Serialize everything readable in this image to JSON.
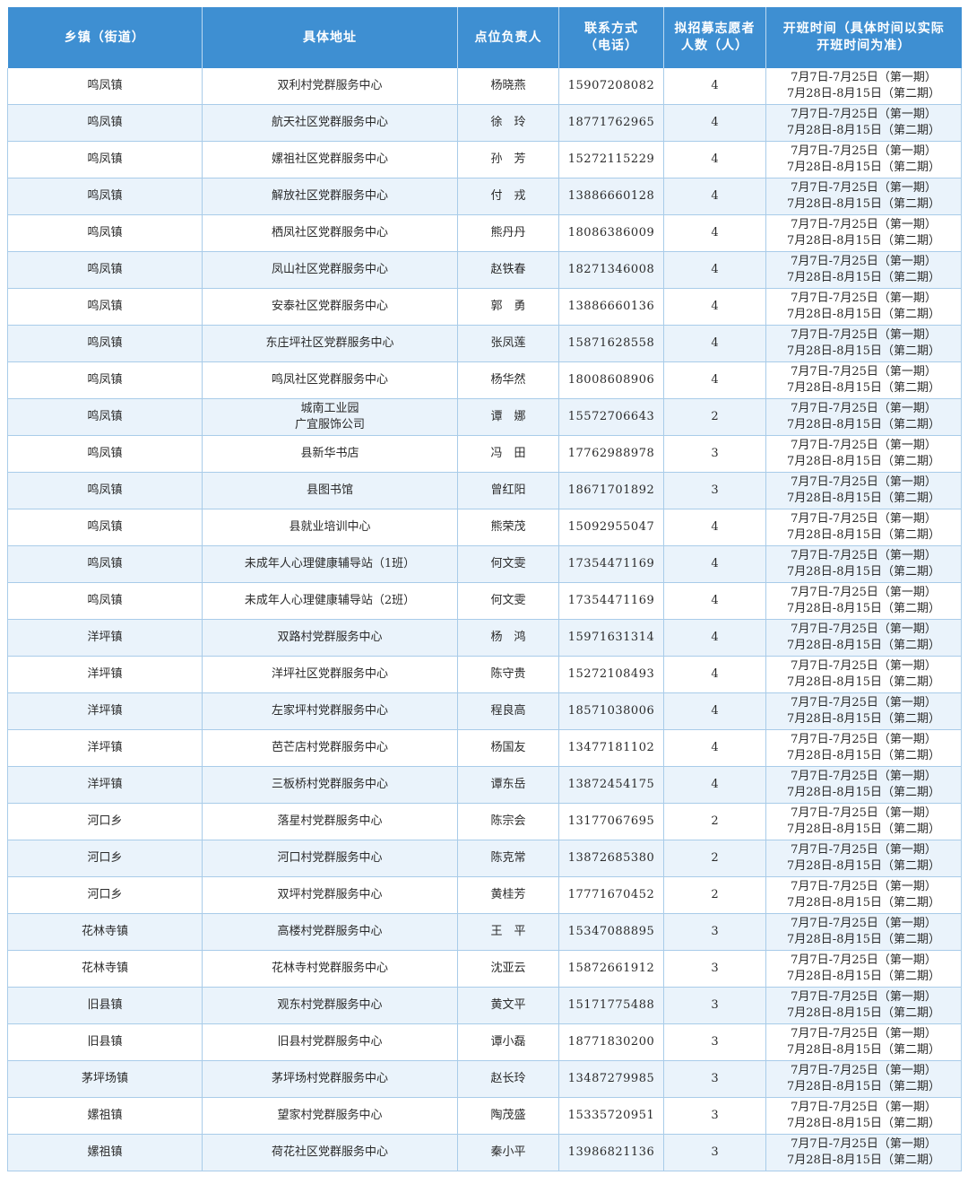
{
  "headers": [
    {
      "line1": "乡镇（街道）",
      "line2": ""
    },
    {
      "line1": "具体地址",
      "line2": ""
    },
    {
      "line1": "点位负责人",
      "line2": ""
    },
    {
      "line1": "联系方式",
      "line2": "（电话）"
    },
    {
      "line1": "拟招募志愿者",
      "line2": "人数（人）"
    },
    {
      "line1": "开班时间（具体时间以实际",
      "line2": "开班时间为准）"
    }
  ],
  "period_line1": "7月7日-7月25日（第一期）",
  "period_line2": "7月28日-8月15日（第二期）",
  "rows": [
    {
      "town": "鸣凤镇",
      "addr1": "双利村党群服务中心",
      "addr2": "",
      "person": "杨晓燕",
      "phone": "15907208082",
      "count": "4"
    },
    {
      "town": "鸣凤镇",
      "addr1": "航天社区党群服务中心",
      "addr2": "",
      "person": "徐　玲",
      "phone": "18771762965",
      "count": "4"
    },
    {
      "town": "鸣凤镇",
      "addr1": "嫘祖社区党群服务中心",
      "addr2": "",
      "person": "孙　芳",
      "phone": "15272115229",
      "count": "4"
    },
    {
      "town": "鸣凤镇",
      "addr1": "解放社区党群服务中心",
      "addr2": "",
      "person": "付　戎",
      "phone": "13886660128",
      "count": "4"
    },
    {
      "town": "鸣凤镇",
      "addr1": "栖凤社区党群服务中心",
      "addr2": "",
      "person": "熊丹丹",
      "phone": "18086386009",
      "count": "4"
    },
    {
      "town": "鸣凤镇",
      "addr1": "凤山社区党群服务中心",
      "addr2": "",
      "person": "赵铁春",
      "phone": "18271346008",
      "count": "4"
    },
    {
      "town": "鸣凤镇",
      "addr1": "安泰社区党群服务中心",
      "addr2": "",
      "person": "郭　勇",
      "phone": "13886660136",
      "count": "4"
    },
    {
      "town": "鸣凤镇",
      "addr1": "东庄坪社区党群服务中心",
      "addr2": "",
      "person": "张凤莲",
      "phone": "15871628558",
      "count": "4"
    },
    {
      "town": "鸣凤镇",
      "addr1": "鸣凤社区党群服务中心",
      "addr2": "",
      "person": "杨华然",
      "phone": "18008608906",
      "count": "4"
    },
    {
      "town": "鸣凤镇",
      "addr1": "城南工业园",
      "addr2": "广宜服饰公司",
      "person": "谭　娜",
      "phone": "15572706643",
      "count": "2"
    },
    {
      "town": "鸣凤镇",
      "addr1": "县新华书店",
      "addr2": "",
      "person": "冯　田",
      "phone": "17762988978",
      "count": "3"
    },
    {
      "town": "鸣凤镇",
      "addr1": "县图书馆",
      "addr2": "",
      "person": "曾红阳",
      "phone": "18671701892",
      "count": "3"
    },
    {
      "town": "鸣凤镇",
      "addr1": "县就业培训中心",
      "addr2": "",
      "person": "熊荣茂",
      "phone": "15092955047",
      "count": "4"
    },
    {
      "town": "鸣凤镇",
      "addr1": "未成年人心理健康辅导站（1班）",
      "addr2": "",
      "person": "何文雯",
      "phone": "17354471169",
      "count": "4"
    },
    {
      "town": "鸣凤镇",
      "addr1": "未成年人心理健康辅导站（2班）",
      "addr2": "",
      "person": "何文雯",
      "phone": "17354471169",
      "count": "4"
    },
    {
      "town": "洋坪镇",
      "addr1": "双路村党群服务中心",
      "addr2": "",
      "person": "杨　鸿",
      "phone": "15971631314",
      "count": "4"
    },
    {
      "town": "洋坪镇",
      "addr1": "洋坪社区党群服务中心",
      "addr2": "",
      "person": "陈守贵",
      "phone": "15272108493",
      "count": "4"
    },
    {
      "town": "洋坪镇",
      "addr1": "左家坪村党群服务中心",
      "addr2": "",
      "person": "程良高",
      "phone": "18571038006",
      "count": "4"
    },
    {
      "town": "洋坪镇",
      "addr1": "芭芒店村党群服务中心",
      "addr2": "",
      "person": "杨国友",
      "phone": "13477181102",
      "count": "4"
    },
    {
      "town": "洋坪镇",
      "addr1": "三板桥村党群服务中心",
      "addr2": "",
      "person": "谭东岳",
      "phone": "13872454175",
      "count": "4"
    },
    {
      "town": "河口乡",
      "addr1": "落星村党群服务中心",
      "addr2": "",
      "person": "陈宗会",
      "phone": "13177067695",
      "count": "2"
    },
    {
      "town": "河口乡",
      "addr1": "河口村党群服务中心",
      "addr2": "",
      "person": "陈克常",
      "phone": "13872685380",
      "count": "2"
    },
    {
      "town": "河口乡",
      "addr1": "双坪村党群服务中心",
      "addr2": "",
      "person": "黄桂芳",
      "phone": "17771670452",
      "count": "2"
    },
    {
      "town": "花林寺镇",
      "addr1": "高楼村党群服务中心",
      "addr2": "",
      "person": "王　平",
      "phone": "15347088895",
      "count": "3"
    },
    {
      "town": "花林寺镇",
      "addr1": "花林寺村党群服务中心",
      "addr2": "",
      "person": "沈亚云",
      "phone": "15872661912",
      "count": "3"
    },
    {
      "town": "旧县镇",
      "addr1": "观东村党群服务中心",
      "addr2": "",
      "person": "黄文平",
      "phone": "15171775488",
      "count": "3"
    },
    {
      "town": "旧县镇",
      "addr1": "旧县村党群服务中心",
      "addr2": "",
      "person": "谭小磊",
      "phone": "18771830200",
      "count": "3"
    },
    {
      "town": "茅坪场镇",
      "addr1": "茅坪场村党群服务中心",
      "addr2": "",
      "person": "赵长玲",
      "phone": "13487279985",
      "count": "3"
    },
    {
      "town": "嫘祖镇",
      "addr1": "望家村党群服务中心",
      "addr2": "",
      "person": "陶茂盛",
      "phone": "15335720951",
      "count": "3"
    },
    {
      "town": "嫘祖镇",
      "addr1": "荷花社区党群服务中心",
      "addr2": "",
      "person": "秦小平",
      "phone": "13986821136",
      "count": "3"
    }
  ]
}
